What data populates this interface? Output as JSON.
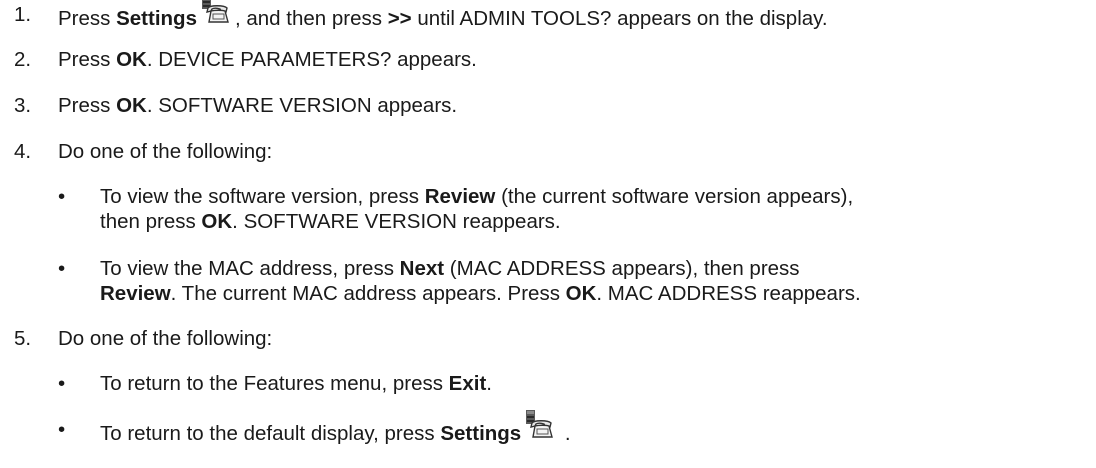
{
  "steps": [
    {
      "num": "1.",
      "parts": [
        {
          "t": "Press "
        },
        {
          "b": "Settings"
        },
        {
          "icon": "settings-phone-icon"
        },
        {
          "t": ", and then press "
        },
        {
          "b": ">>"
        },
        {
          "t": " until ADMIN TOOLS? appears on the display."
        }
      ]
    },
    {
      "num": "2.",
      "parts": [
        {
          "t": "Press "
        },
        {
          "b": "OK"
        },
        {
          "t": ". DEVICE PARAMETERS? appears."
        }
      ]
    },
    {
      "num": "3.",
      "parts": [
        {
          "t": "Press "
        },
        {
          "b": "OK"
        },
        {
          "t": ". SOFTWARE VERSION appears."
        }
      ]
    },
    {
      "num": "4.",
      "parts": [
        {
          "t": "Do one of the following:"
        }
      ],
      "bullets": [
        {
          "symbol": "•",
          "parts": [
            {
              "t": "To view the software version, press "
            },
            {
              "b": "Review"
            },
            {
              "t": " (the current software version appears),"
            },
            {
              "br": true
            },
            {
              "t": "then press "
            },
            {
              "b": "OK"
            },
            {
              "t": ". SOFTWARE VERSION reappears."
            }
          ]
        },
        {
          "symbol": "•",
          "parts": [
            {
              "t": "To view the MAC address, press "
            },
            {
              "b": "Next"
            },
            {
              "t": " (MAC ADDRESS appears), then press"
            },
            {
              "br": true
            },
            {
              "b": "Review"
            },
            {
              "t": ". The current MAC address appears. Press "
            },
            {
              "b": "OK"
            },
            {
              "t": ". MAC ADDRESS reappears."
            }
          ]
        }
      ]
    },
    {
      "num": "5.",
      "parts": [
        {
          "t": "Do one of the following:"
        }
      ],
      "bullets": [
        {
          "symbol": "•",
          "parts": [
            {
              "t": "To return to the Features menu, press "
            },
            {
              "b": "Exit"
            },
            {
              "t": "."
            }
          ]
        },
        {
          "symbol": "•",
          "parts": [
            {
              "t": "To return to the default display, press "
            },
            {
              "b": "Settings"
            },
            {
              "icon": "settings-phone-icon"
            },
            {
              "t": " ."
            }
          ]
        }
      ]
    }
  ]
}
